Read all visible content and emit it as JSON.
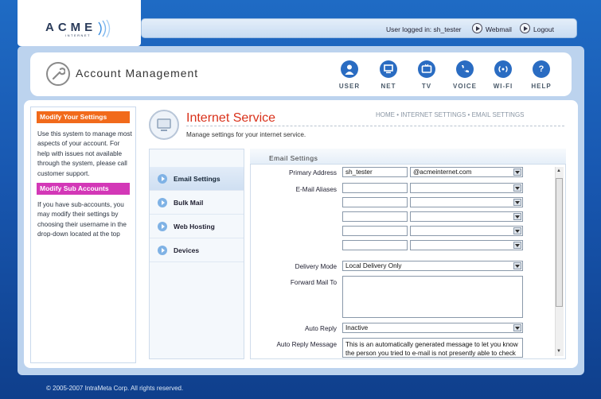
{
  "brand": {
    "name": "ACME",
    "sub": "INTERNET"
  },
  "userbar": {
    "logged_in": "User logged in: sh_tester",
    "webmail": "Webmail",
    "logout": "Logout"
  },
  "header": {
    "title": "Account Management"
  },
  "nav": [
    {
      "label": "USER",
      "icon": "user-icon"
    },
    {
      "label": "NET",
      "icon": "net-icon"
    },
    {
      "label": "TV",
      "icon": "tv-icon"
    },
    {
      "label": "VOICE",
      "icon": "voice-icon"
    },
    {
      "label": "WI-FI",
      "icon": "wifi-icon"
    },
    {
      "label": "HELP",
      "icon": "help-icon"
    }
  ],
  "sidebar": {
    "section1_title": "Modify Your Settings",
    "section1_text": "Use this system to manage most aspects of your account.  For help with issues not available through the system, please call customer support.",
    "section2_title": "Modify Sub Accounts",
    "section2_text": "If you have sub-accounts, you may modify their settings by choosing their username in the drop-down located at the top",
    "color1": "#f16a1b",
    "color2": "#d338b7"
  },
  "service": {
    "title": "Internet Service",
    "subtitle": "Manage settings for your internet service.",
    "breadcrumb": "HOME • INTERNET SETTINGS • EMAIL SETTINGS"
  },
  "subnav": [
    "Email Settings",
    "Bulk Mail",
    "Web Hosting",
    "Devices"
  ],
  "form": {
    "title": "Email Settings",
    "primary_label": "Primary Address",
    "primary_value": "sh_tester",
    "domain_value": "@acmeinternet.com",
    "aliases_label": "E-Mail Aliases",
    "delivery_label": "Delivery Mode",
    "delivery_value": "Local Delivery Only",
    "forward_label": "Forward Mail To",
    "autoreply_label": "Auto Reply",
    "autoreply_value": "Inactive",
    "autoreply_msg_label": "Auto Reply Message",
    "autoreply_msg_value": "This is an automatically generated message to let you know the person you tried to e-mail is not presently able to check"
  },
  "footer": "© 2005-2007 IntraMeta Corp. All rights reserved."
}
